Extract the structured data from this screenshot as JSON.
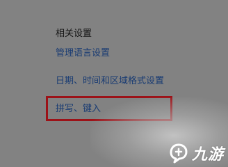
{
  "related_settings": {
    "title": "相关设置",
    "links": [
      {
        "label": "管理语言设置"
      },
      {
        "label": "日期、时间和区域格式设置"
      },
      {
        "label": "拼写、键入"
      }
    ]
  },
  "watermark": {
    "text": "九游",
    "icon": "jiuyou-logo-icon"
  },
  "colors": {
    "background": "#828282",
    "link": "#1a3c73",
    "highlight": "#9c1218"
  }
}
